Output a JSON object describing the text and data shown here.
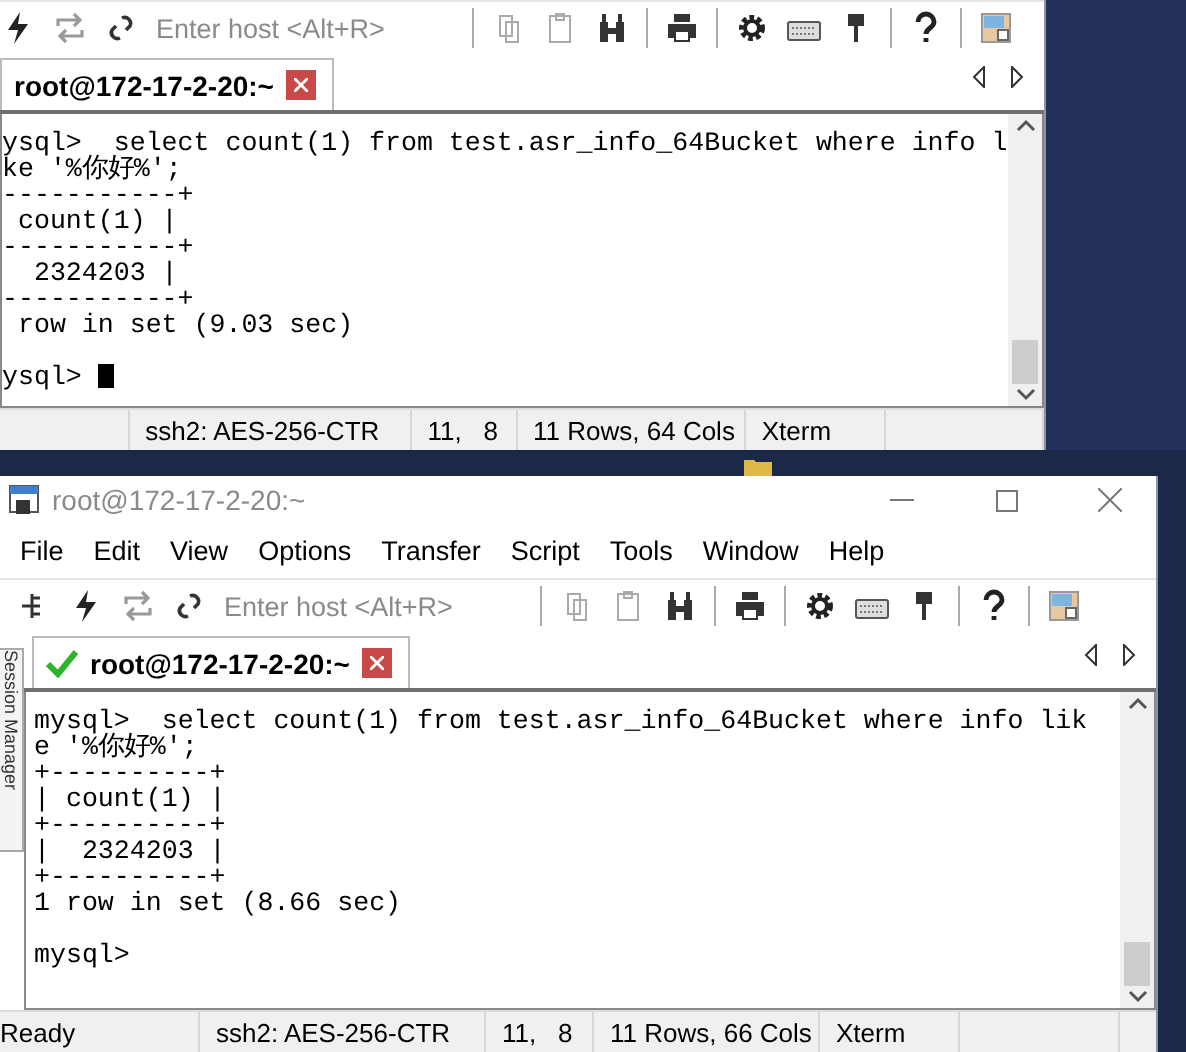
{
  "windows": [
    {
      "toolbar": {
        "host_placeholder": "Enter host <Alt+R>"
      },
      "tabs": [
        {
          "label": "root@172-17-2-20:~",
          "connected": false,
          "selected": true
        }
      ],
      "terminal": {
        "output": [
          "ysql>  select count(1) from test.asr_info_64Bucket where info l",
          "ke '%你好%';",
          "-----------+",
          " count(1) |",
          "-----------+",
          "  2324203 |",
          "-----------+",
          " row in set (9.03 sec)"
        ],
        "prompt": "ysql> ",
        "cursor": true
      },
      "status_bar": [
        "ssh2: AES-256-CTR",
        "11,   8",
        "11 Rows, 64 Cols",
        "Xterm"
      ]
    },
    {
      "title": "root@172-17-2-20:~",
      "menu": [
        "File",
        "Edit",
        "View",
        "Options",
        "Transfer",
        "Script",
        "Tools",
        "Window",
        "Help"
      ],
      "toolbar": {
        "host_placeholder": "Enter host <Alt+R>"
      },
      "session_manager": "Session Manager",
      "tabs": [
        {
          "label": "root@172-17-2-20:~",
          "connected": true,
          "selected": true
        }
      ],
      "terminal": {
        "output": [
          "mysql>  select count(1) from test.asr_info_64Bucket where info lik",
          "e '%你好%';",
          "+----------+",
          "| count(1) |",
          "+----------+",
          "|  2324203 |",
          "+----------+",
          "1 row in set (8.66 sec)"
        ],
        "prompt": "mysql> ",
        "cursor": false
      },
      "status_bar": [
        "Ready",
        "ssh2: AES-256-CTR",
        "11,   8",
        "11 Rows, 66 Cols",
        "Xterm"
      ]
    }
  ]
}
